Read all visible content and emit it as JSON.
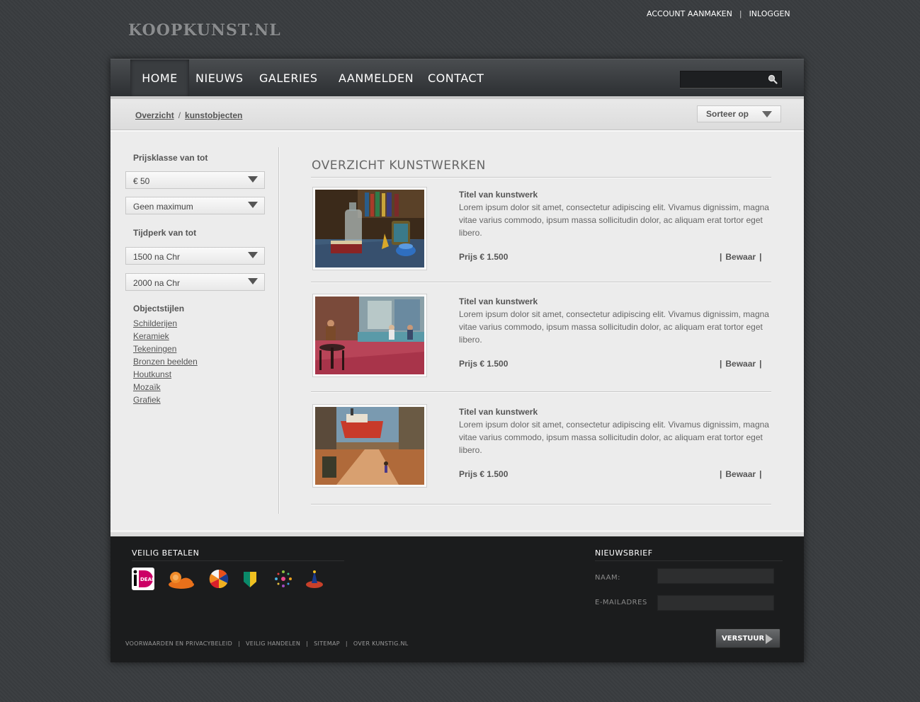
{
  "site": {
    "logo": "KOOPKUNST.NL"
  },
  "toplinks": {
    "account": "ACCOUNT AANMAKEN",
    "separator": "|",
    "login": "INLOGGEN"
  },
  "nav": {
    "items": [
      {
        "label": "HOME",
        "active": true
      },
      {
        "label": "NIEUWS"
      },
      {
        "label": "GALERIES"
      },
      {
        "label": "AANMELDEN"
      },
      {
        "label": "CONTACT"
      }
    ],
    "search_value": "",
    "search_icon": "magnifier-icon"
  },
  "breadcrumb": {
    "items": [
      "Overzicht",
      "kunstobjecten"
    ],
    "separator": "/"
  },
  "sort": {
    "label": "Sorteer op"
  },
  "sidebar": {
    "price_label": "Prijsklasse van tot",
    "price_min": "€ 50",
    "price_max": "Geen maximum",
    "era_label": "Tijdperk van tot",
    "era_from": "1500 na Chr",
    "era_to": "2000 na Chr",
    "styles_label": "Objectstijlen",
    "styles": [
      "Schilderijen",
      "Keramiek",
      "Tekeningen",
      "Bronzen beelden",
      "Houtkunst",
      "Mozaïk",
      "Grafiek"
    ]
  },
  "main": {
    "title": "OVERZICHT KUNSTWERKEN",
    "items": [
      {
        "title": "Titel van kunstwerk",
        "desc": "Lorem ipsum dolor sit amet, consectetur adipiscing elit. Vivamus dignissim, magna vitae varius commodo, ipsum massa sollicitudin dolor, ac aliquam erat tortor eget libero.",
        "price": "Prijs € 1.500",
        "save": "Bewaar",
        "image": "still-life-painting"
      },
      {
        "title": "Titel van kunstwerk",
        "desc": "Lorem ipsum dolor sit amet, consectetur adipiscing elit. Vivamus dignissim, magna vitae varius commodo, ipsum massa sollicitudin dolor, ac aliquam erat tortor eget libero.",
        "price": "Prijs € 1.500",
        "save": "Bewaar",
        "image": "cafe-interior-painting"
      },
      {
        "title": "Titel van kunstwerk",
        "desc": "Lorem ipsum dolor sit amet, consectetur adipiscing elit. Vivamus dignissim, magna vitae varius commodo, ipsum massa sollicitudin dolor, ac aliquam erat tortor eget libero.",
        "price": "Prijs € 1.500",
        "save": "Bewaar",
        "image": "shipyard-painting"
      }
    ],
    "save_separator": "|"
  },
  "footer": {
    "payment_title": "VEILIG BETALEN",
    "payment_icons": [
      "ideal-logo",
      "ing-lion-logo",
      "rabobank-logo",
      "abn-amro-logo",
      "sns-logo",
      "fortis-logo"
    ],
    "newsletter_title": "NIEUWSBRIEF",
    "name_label": "NAAM:",
    "email_label": "E-MAILADRES",
    "submit_label": "VERSTUUR",
    "links": [
      "VOORWAARDEN EN PRIVACYBELEID",
      "VEILIG HANDELEN",
      "SITEMAP",
      "OVER KUNSTIG.NL"
    ],
    "link_separator": "|"
  }
}
